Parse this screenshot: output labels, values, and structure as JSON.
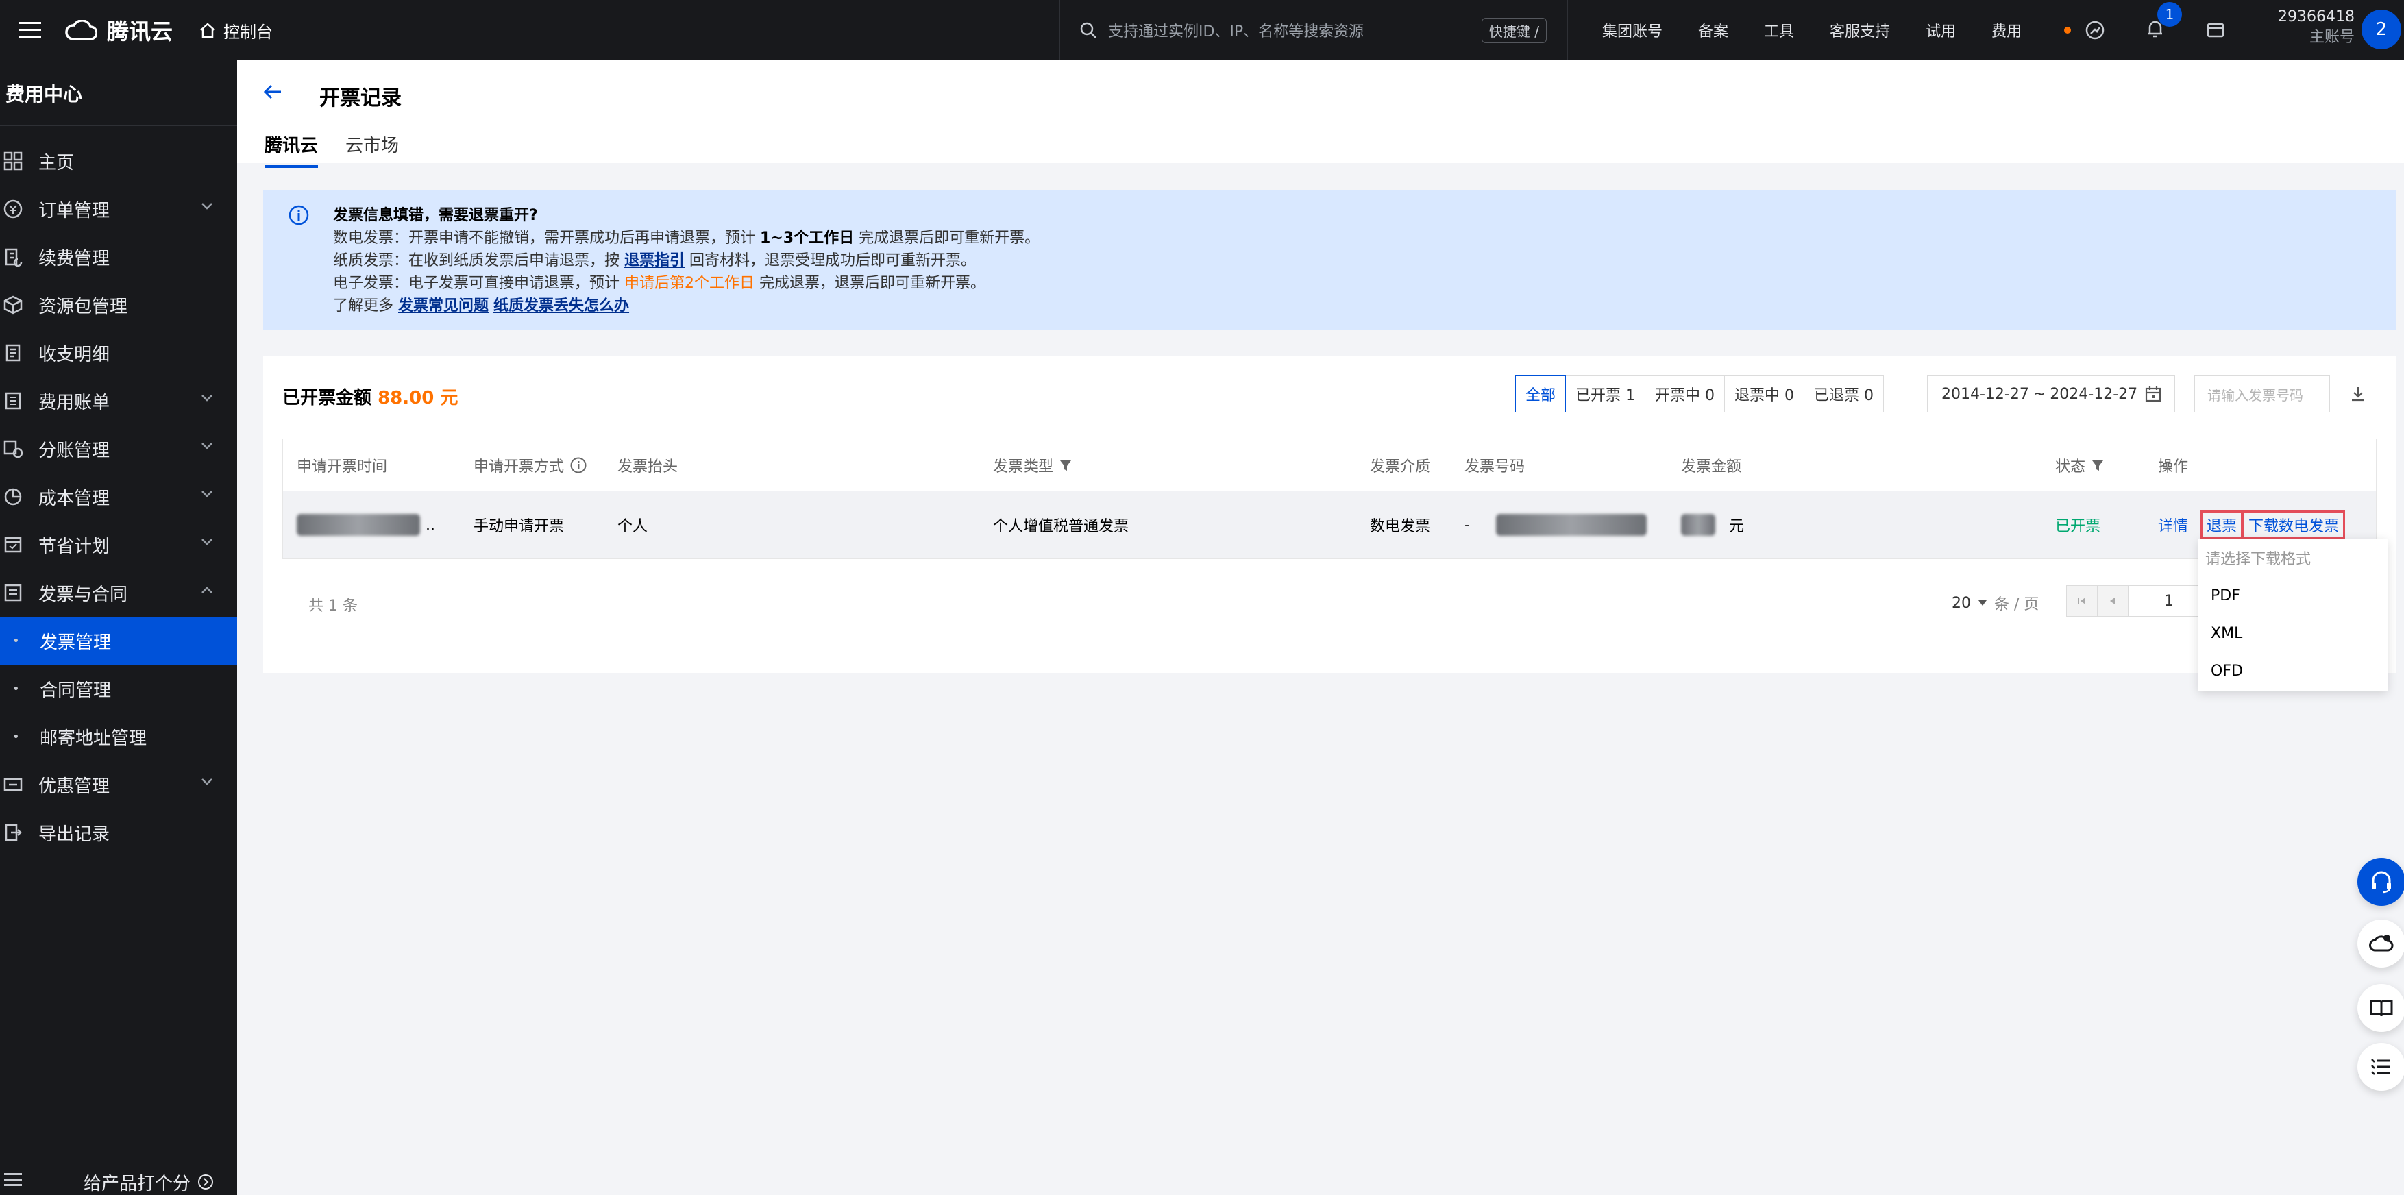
{
  "topbar": {
    "brand": "腾讯云",
    "console": "控制台",
    "search_placeholder": "支持通过实例ID、IP、名称等搜索资源",
    "shortcut": "快捷键 /",
    "nav": [
      "集团账号",
      "备案",
      "工具",
      "客服支持",
      "试用",
      "费用"
    ],
    "notification_count": "1",
    "account_id": "29366418",
    "account_type": "主账号",
    "avatar": "2"
  },
  "sidebar": {
    "title": "费用中心",
    "items": [
      {
        "label": "主页",
        "icon": "home-grid-icon",
        "chevron": false
      },
      {
        "label": "订单管理",
        "icon": "order-icon",
        "chevron": true
      },
      {
        "label": "续费管理",
        "icon": "renew-icon",
        "chevron": false
      },
      {
        "label": "资源包管理",
        "icon": "package-icon",
        "chevron": false
      },
      {
        "label": "收支明细",
        "icon": "ledger-icon",
        "chevron": false
      },
      {
        "label": "费用账单",
        "icon": "bill-icon",
        "chevron": true
      },
      {
        "label": "分账管理",
        "icon": "split-icon",
        "chevron": true
      },
      {
        "label": "成本管理",
        "icon": "pie-icon",
        "chevron": true
      },
      {
        "label": "节省计划",
        "icon": "plan-icon",
        "chevron": true
      },
      {
        "label": "发票与合同",
        "icon": "invoice-icon",
        "chevron": true
      }
    ],
    "sub_items": [
      "发票管理",
      "合同管理",
      "邮寄地址管理"
    ],
    "items_after": [
      {
        "label": "优惠管理",
        "icon": "coupon-icon",
        "chevron": true
      },
      {
        "label": "导出记录",
        "icon": "export-icon",
        "chevron": false
      }
    ],
    "feedback": "给产品打个分"
  },
  "header": {
    "title": "开票记录",
    "tabs": [
      "腾讯云",
      "云市场"
    ]
  },
  "notice": {
    "title": "发票信息填错，需要退票重开?",
    "line1_a": "数电发票：开票申请不能撤销，需开票成功后再申请退票，预计",
    "line1_b": "1~3个工作日",
    "line1_c": "完成退票后即可重新开票。",
    "line2_a": "纸质发票：在收到纸质发票后申请退票，按",
    "line2_b": "退票指引",
    "line2_c": "回寄材料，退票受理成功后即可重新开票。",
    "line3_a": "电子发票：电子发票可直接申请退票，预计",
    "line3_b": "申请后第2个工作日",
    "line3_c": "完成退票，退票后即可重新开票。",
    "line4_a": "了解更多",
    "line4_b": "发票常见问题",
    "line4_c": "纸质发票丢失怎么办"
  },
  "summary": {
    "label": "已开票金额",
    "value": "88.00 元"
  },
  "filters": [
    "全部",
    "已开票 1",
    "开票中 0",
    "退票中 0",
    "已退票 0"
  ],
  "date_range": {
    "start": "2014-12-27",
    "separator": "~",
    "end": "2024-12-27"
  },
  "invoice_search_placeholder": "请输入发票号码",
  "table": {
    "columns": [
      "申请开票时间",
      "申请开票方式",
      "发票抬头",
      "发票类型",
      "发票介质",
      "发票号码",
      "发票金额",
      "状态",
      "操作"
    ],
    "row": {
      "time_tail": "..",
      "method": "手动申请开票",
      "title": "个人",
      "type": "个人增值税普通发票",
      "medium": "数电发票",
      "number_prefix": "-",
      "amount_suffix": "元",
      "status": "已开票",
      "actions": [
        "详情",
        "退票",
        "下载数电发票"
      ]
    }
  },
  "pagination": {
    "total": "共 1 条",
    "page_size": "20",
    "unit": "条 / 页",
    "current_page": "1"
  },
  "download_menu": {
    "header": "请选择下载格式",
    "options": [
      "PDF",
      "XML",
      "OFD"
    ]
  },
  "colors": {
    "brand_blue": "#0052d9",
    "accent_orange": "#ff7200",
    "success_green": "#00a870",
    "dark_bg": "#18191c",
    "notice_bg": "#d9e8ff"
  }
}
